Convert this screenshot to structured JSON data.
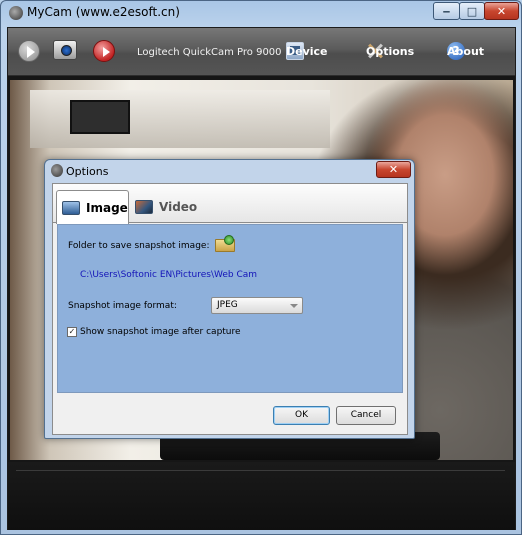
{
  "window": {
    "title": "MyCam (www.e2esoft.cn)",
    "minimize_glyph": "‒",
    "maximize_glyph": "□",
    "close_glyph": "✕"
  },
  "toolbar": {
    "device_name": "Logitech QuickCam Pro 9000",
    "device_label": "Device",
    "options_label": "Options",
    "about_label": "About",
    "about_glyph": "?"
  },
  "dialog": {
    "title": "Options",
    "close_glyph": "✕",
    "tabs": [
      {
        "label": "Image",
        "icon": "image-tab-icon",
        "selected": true
      },
      {
        "label": "Video",
        "icon": "video-tab-icon",
        "selected": false
      }
    ],
    "image_tab": {
      "folder_label": "Folder to save snapshot image:",
      "folder_path": "C:\\Users\\Softonic EN\\Pictures\\Web Cam",
      "format_label": "Snapshot image format:",
      "format_value": "JPEG",
      "show_snapshot_label": "Show snapshot image after capture",
      "show_snapshot_checked": true,
      "check_glyph": "✓"
    },
    "ok_label": "OK",
    "cancel_label": "Cancel"
  },
  "colors": {
    "panel_bg": "#8eb0db",
    "path_text": "#1414b8",
    "record_red": "#c22424"
  }
}
